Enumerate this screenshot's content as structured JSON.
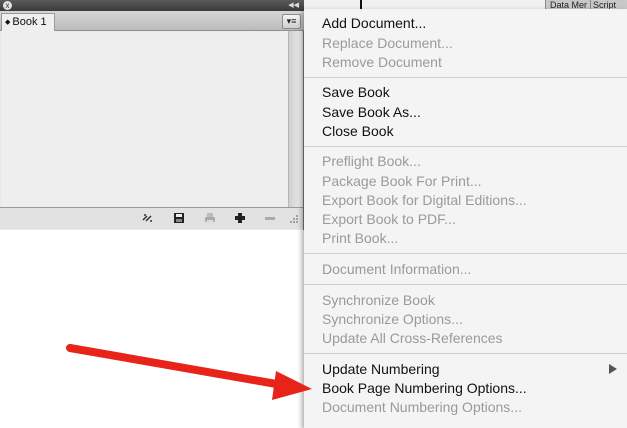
{
  "panel": {
    "tab_label": "Book 1",
    "tab_arrows": "◆",
    "close_icon": "x",
    "collapse_icon": "◀◀",
    "menu_icon": "▾≡"
  },
  "background": {
    "data_tab": "Data Mer",
    "script_tab": "Script"
  },
  "menu": {
    "items": [
      {
        "label": "Add Document...",
        "enabled": true
      },
      {
        "label": "Replace Document...",
        "enabled": false
      },
      {
        "label": "Remove Document",
        "enabled": false
      },
      {
        "label": "Save Book",
        "enabled": true
      },
      {
        "label": "Save Book As...",
        "enabled": true
      },
      {
        "label": "Close Book",
        "enabled": true
      },
      {
        "label": "Preflight Book...",
        "enabled": false
      },
      {
        "label": "Package Book For Print...",
        "enabled": false
      },
      {
        "label": "Export Book for Digital Editions...",
        "enabled": false
      },
      {
        "label": "Export Book to PDF...",
        "enabled": false
      },
      {
        "label": "Print Book...",
        "enabled": false
      },
      {
        "label": "Document Information...",
        "enabled": false
      },
      {
        "label": "Synchronize Book",
        "enabled": false
      },
      {
        "label": "Synchronize Options...",
        "enabled": false
      },
      {
        "label": "Update All Cross-References",
        "enabled": false
      },
      {
        "label": "Update Numbering",
        "enabled": true,
        "submenu": true
      },
      {
        "label": "Book Page Numbering Options...",
        "enabled": true
      },
      {
        "label": "Document Numbering Options...",
        "enabled": false
      }
    ]
  },
  "icons": [
    "sync-styles-icon",
    "save-book-icon",
    "print-book-icon",
    "add-document-icon",
    "remove-document-icon",
    "resize-grip-icon"
  ],
  "annotation_color": "#e8231a"
}
